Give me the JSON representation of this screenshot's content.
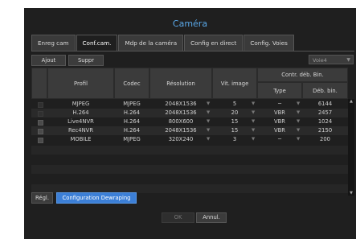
{
  "window_title": "Caméra",
  "tabs": [
    {
      "label": "Enreg cam"
    },
    {
      "label": "Conf.cam."
    },
    {
      "label": "Mdp de la caméra"
    },
    {
      "label": "Config en direct"
    },
    {
      "label": "Config. Voies"
    }
  ],
  "active_tab": 1,
  "toolbar": {
    "add_label": "Ajout",
    "delete_label": "Suppr"
  },
  "channel_select": {
    "value": "Voie4"
  },
  "table": {
    "headers": {
      "profile": "Profil",
      "codec": "Codec",
      "resolution": "Résolution",
      "fps": "Vit. image",
      "bitrate_group": "Contr. déb. Bin.",
      "type": "Type",
      "bitrate": "Déb. bin."
    },
    "rows": [
      {
        "profile": "MJPEG",
        "codec": "MJPEG",
        "resolution": "2048X1536",
        "fps": "5",
        "type": "─",
        "bitrate": "6144"
      },
      {
        "profile": "H.264",
        "codec": "H.264",
        "resolution": "2048X1536",
        "fps": "20",
        "type": "VBR",
        "bitrate": "2457"
      },
      {
        "profile": "Live4NVR",
        "codec": "H.264",
        "resolution": "800X600",
        "fps": "15",
        "type": "VBR",
        "bitrate": "1024"
      },
      {
        "profile": "Rec4NVR",
        "codec": "H.264",
        "resolution": "2048X1536",
        "fps": "15",
        "type": "VBR",
        "bitrate": "2150"
      },
      {
        "profile": "MOBILE",
        "codec": "MJPEG",
        "resolution": "320X240",
        "fps": "3",
        "type": "─",
        "bitrate": "200"
      }
    ]
  },
  "footer": {
    "settings_label": "Régl.",
    "dewarping_label": "Configuration Dewraping",
    "ok_label": "OK",
    "cancel_label": "Annul."
  },
  "colors": {
    "accent": "#3c7fd6",
    "title": "#5aa8e8",
    "background": "#1f1f1f"
  }
}
